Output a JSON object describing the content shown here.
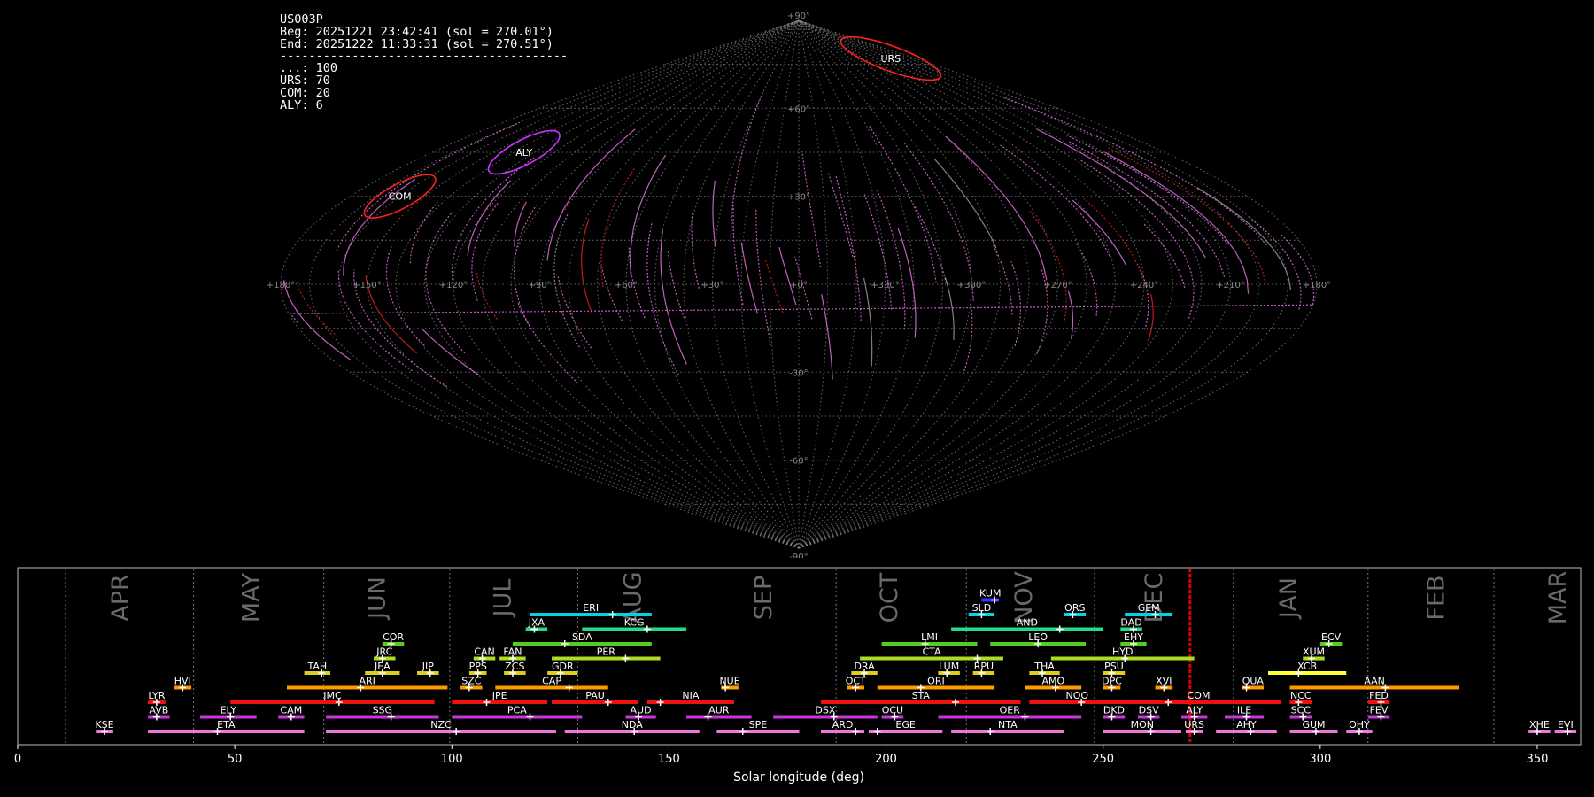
{
  "header": {
    "station": "US003P",
    "begin": "Beg: 20251221 23:42:41 (sol = 270.01°)",
    "end": "End: 20251222 11:33:31 (sol = 270.51°)",
    "separator": "----------------------------------------",
    "counts": [
      "...: 100",
      "URS: 70",
      "COM: 20",
      "ALY: 6"
    ]
  },
  "sky_map": {
    "projection": "sinusoidal",
    "lat_labels": [
      "+90°",
      "+60°",
      "+30°",
      "-30°",
      "-60°",
      "-90°"
    ],
    "lon_labels": [
      "+180°",
      "+150°",
      "+120°",
      "+90°",
      "+60°",
      "+30°",
      "+0°",
      "+330°",
      "+300°",
      "+270°",
      "+240°",
      "+210°",
      "+180°"
    ],
    "radiants": [
      {
        "code": "URS",
        "ra": 218,
        "dec": 77,
        "color": "#ff2020"
      },
      {
        "code": "ALY",
        "ra": 135,
        "dec": 45,
        "color": "#cc33ff"
      },
      {
        "code": "COM",
        "ra": 160,
        "dec": 30,
        "color": "#ff2020"
      }
    ]
  },
  "chart_data": {
    "type": "timeline",
    "xlabel": "Solar longitude (deg)",
    "xlim": [
      0,
      360
    ],
    "xticks": [
      0,
      50,
      100,
      150,
      200,
      250,
      300,
      350
    ],
    "current_sol": 270.01,
    "months": [
      {
        "name": "APR",
        "start": 11,
        "center": 24
      },
      {
        "name": "MAY",
        "start": 40.5,
        "center": 54
      },
      {
        "name": "JUN",
        "start": 70.5,
        "center": 83
      },
      {
        "name": "JUL",
        "start": 99.5,
        "center": 112
      },
      {
        "name": "AUG",
        "start": 129,
        "center": 142
      },
      {
        "name": "SEP",
        "start": 159,
        "center": 172
      },
      {
        "name": "OCT",
        "start": 188.5,
        "center": 201
      },
      {
        "name": "NOV",
        "start": 218.5,
        "center": 232
      },
      {
        "name": "DEC",
        "start": 248,
        "center": 262
      },
      {
        "name": "JAN",
        "start": 280,
        "center": 293
      },
      {
        "name": "FEB",
        "start": 311,
        "center": 327
      },
      {
        "name": "MAR",
        "start": 340,
        "center": 355
      }
    ],
    "showers": [
      {
        "code": "KUM",
        "start": 222,
        "end": 226,
        "peak": 225,
        "row": 10,
        "color": "#3333ff"
      },
      {
        "code": "ERI",
        "start": 118,
        "end": 146,
        "peak": 137,
        "row": 9,
        "color": "#00d4e6"
      },
      {
        "code": "SLD",
        "start": 219,
        "end": 225,
        "peak": 222,
        "row": 9,
        "color": "#00d4e6"
      },
      {
        "code": "ORS",
        "start": 241,
        "end": 246,
        "peak": 243,
        "row": 9,
        "color": "#00d4e6"
      },
      {
        "code": "GEM",
        "start": 255,
        "end": 266,
        "peak": 262,
        "row": 9,
        "color": "#00d4e6"
      },
      {
        "code": "JXA",
        "start": 117,
        "end": 122,
        "peak": 119,
        "row": 8,
        "color": "#22dd88"
      },
      {
        "code": "KCG",
        "start": 130,
        "end": 154,
        "peak": 145,
        "row": 8,
        "color": "#22dd88"
      },
      {
        "code": "AND",
        "start": 215,
        "end": 250,
        "peak": 240,
        "row": 8,
        "color": "#22dd88"
      },
      {
        "code": "DAD",
        "start": 254,
        "end": 259,
        "peak": 257,
        "row": 8,
        "color": "#22dd88"
      },
      {
        "code": "COR",
        "start": 84,
        "end": 89,
        "peak": 86,
        "row": 7,
        "color": "#55cc22"
      },
      {
        "code": "SDA",
        "start": 114,
        "end": 146,
        "peak": 126,
        "row": 7,
        "color": "#55cc22"
      },
      {
        "code": "LMI",
        "start": 199,
        "end": 221,
        "peak": 209,
        "row": 7,
        "color": "#55cc22"
      },
      {
        "code": "LEO",
        "start": 224,
        "end": 246,
        "peak": 235,
        "row": 7,
        "color": "#55cc22"
      },
      {
        "code": "EHY",
        "start": 254,
        "end": 260,
        "peak": 257,
        "row": 7,
        "color": "#55cc22"
      },
      {
        "code": "ECV",
        "start": 300,
        "end": 305,
        "peak": 302,
        "row": 7,
        "color": "#55cc22"
      },
      {
        "code": "JRC",
        "start": 82,
        "end": 87,
        "peak": 84,
        "row": 6,
        "color": "#aadd22"
      },
      {
        "code": "CAN",
        "start": 105,
        "end": 110,
        "peak": 107,
        "row": 6,
        "color": "#aadd22"
      },
      {
        "code": "FAN",
        "start": 111,
        "end": 117,
        "peak": 114,
        "row": 6,
        "color": "#aadd22"
      },
      {
        "code": "PER",
        "start": 123,
        "end": 148,
        "peak": 140,
        "row": 6,
        "color": "#aadd22"
      },
      {
        "code": "CTA",
        "start": 194,
        "end": 227,
        "peak": 221,
        "row": 6,
        "color": "#aadd22"
      },
      {
        "code": "HYD",
        "start": 238,
        "end": 271,
        "peak": 255,
        "row": 6,
        "color": "#aadd22"
      },
      {
        "code": "XUM",
        "start": 296,
        "end": 301,
        "peak": 298,
        "row": 6,
        "color": "#aadd22"
      },
      {
        "code": "TAH",
        "start": 66,
        "end": 72,
        "peak": 70,
        "row": 5,
        "color": "#ddcc22"
      },
      {
        "code": "JEA",
        "start": 80,
        "end": 88,
        "peak": 84,
        "row": 5,
        "color": "#ddcc22"
      },
      {
        "code": "JIP",
        "start": 92,
        "end": 97,
        "peak": 95,
        "row": 5,
        "color": "#ddcc22"
      },
      {
        "code": "PPS",
        "start": 104,
        "end": 108,
        "peak": 106,
        "row": 5,
        "color": "#ddcc22"
      },
      {
        "code": "ZCS",
        "start": 112,
        "end": 117,
        "peak": 114,
        "row": 5,
        "color": "#ddcc22"
      },
      {
        "code": "GDR",
        "start": 122,
        "end": 129,
        "peak": 125,
        "row": 5,
        "color": "#ddcc22"
      },
      {
        "code": "DRA",
        "start": 192,
        "end": 198,
        "peak": 195,
        "row": 5,
        "color": "#ddcc22"
      },
      {
        "code": "LUM",
        "start": 212,
        "end": 217,
        "peak": 214,
        "row": 5,
        "color": "#ddcc22"
      },
      {
        "code": "RPU",
        "start": 220,
        "end": 225,
        "peak": 222,
        "row": 5,
        "color": "#ddcc22"
      },
      {
        "code": "THA",
        "start": 233,
        "end": 240,
        "peak": 236,
        "row": 5,
        "color": "#ddcc22"
      },
      {
        "code": "PSU",
        "start": 250,
        "end": 255,
        "peak": 252,
        "row": 5,
        "color": "#ddcc22"
      },
      {
        "code": "XCB",
        "start": 288,
        "end": 306,
        "peak": 295,
        "row": 5,
        "color": "#ffff33"
      },
      {
        "code": "HVI",
        "start": 36,
        "end": 40,
        "peak": 38,
        "row": 4,
        "color": "#ff9900"
      },
      {
        "code": "ARI",
        "start": 62,
        "end": 99,
        "peak": 79,
        "row": 4,
        "color": "#ff9900"
      },
      {
        "code": "SZC",
        "start": 102,
        "end": 107,
        "peak": 104,
        "row": 4,
        "color": "#ff9900"
      },
      {
        "code": "CAP",
        "start": 110,
        "end": 136,
        "peak": 127,
        "row": 4,
        "color": "#ff9900"
      },
      {
        "code": "NUE",
        "start": 162,
        "end": 166,
        "peak": 163,
        "row": 4,
        "color": "#ff9900"
      },
      {
        "code": "OCT",
        "start": 191,
        "end": 195,
        "peak": 193,
        "row": 4,
        "color": "#ff9900"
      },
      {
        "code": "ORI",
        "start": 198,
        "end": 225,
        "peak": 208,
        "row": 4,
        "color": "#ff9900"
      },
      {
        "code": "AMO",
        "start": 232,
        "end": 245,
        "peak": 239,
        "row": 4,
        "color": "#ff9900"
      },
      {
        "code": "DPC",
        "start": 250,
        "end": 254,
        "peak": 252,
        "row": 4,
        "color": "#ff9900"
      },
      {
        "code": "XVI",
        "start": 262,
        "end": 266,
        "peak": 264,
        "row": 4,
        "color": "#ff9900"
      },
      {
        "code": "QUA",
        "start": 282,
        "end": 287,
        "peak": 283,
        "row": 4,
        "color": "#ff9900"
      },
      {
        "code": "AAN",
        "start": 293,
        "end": 332,
        "peak": 315,
        "row": 4,
        "color": "#ff9900"
      },
      {
        "code": "LYR",
        "start": 30,
        "end": 34,
        "peak": 32,
        "row": 3,
        "color": "#ee1111"
      },
      {
        "code": "JMC",
        "start": 49,
        "end": 96,
        "peak": 74,
        "row": 3,
        "color": "#ee1111"
      },
      {
        "code": "JPE",
        "start": 100,
        "end": 122,
        "peak": 108,
        "row": 3,
        "color": "#ee1111"
      },
      {
        "code": "PAU",
        "start": 123,
        "end": 143,
        "peak": 136,
        "row": 3,
        "color": "#ee1111"
      },
      {
        "code": "NIA",
        "start": 145,
        "end": 165,
        "peak": 148,
        "row": 3,
        "color": "#ee1111"
      },
      {
        "code": "STA",
        "start": 185,
        "end": 231,
        "peak": 216,
        "row": 3,
        "color": "#ee1111"
      },
      {
        "code": "NOO",
        "start": 233,
        "end": 255,
        "peak": 245,
        "row": 3,
        "color": "#ee1111"
      },
      {
        "code": "COM",
        "start": 253,
        "end": 291,
        "peak": 265,
        "row": 3,
        "color": "#ee1111"
      },
      {
        "code": "NCC",
        "start": 293,
        "end": 298,
        "peak": 295,
        "row": 3,
        "color": "#ee1111"
      },
      {
        "code": "FED",
        "start": 311,
        "end": 316,
        "peak": 314,
        "row": 3,
        "color": "#ee1111"
      },
      {
        "code": "AVB",
        "start": 30,
        "end": 35,
        "peak": 32,
        "row": 2,
        "color": "#cc33dd"
      },
      {
        "code": "ELY",
        "start": 42,
        "end": 55,
        "peak": 49,
        "row": 2,
        "color": "#cc33dd"
      },
      {
        "code": "CAM",
        "start": 60,
        "end": 66,
        "peak": 63,
        "row": 2,
        "color": "#cc33dd"
      },
      {
        "code": "SSG",
        "start": 71,
        "end": 97,
        "peak": 86,
        "row": 2,
        "color": "#cc33dd"
      },
      {
        "code": "PCA",
        "start": 100,
        "end": 130,
        "peak": 118,
        "row": 2,
        "color": "#cc33dd"
      },
      {
        "code": "AUD",
        "start": 140,
        "end": 147,
        "peak": 143,
        "row": 2,
        "color": "#cc33dd"
      },
      {
        "code": "AUR",
        "start": 154,
        "end": 169,
        "peak": 159,
        "row": 2,
        "color": "#cc33dd"
      },
      {
        "code": "DSX",
        "start": 174,
        "end": 198,
        "peak": 188,
        "row": 2,
        "color": "#cc33dd"
      },
      {
        "code": "OCU",
        "start": 199,
        "end": 204,
        "peak": 202,
        "row": 2,
        "color": "#cc33dd"
      },
      {
        "code": "OER",
        "start": 212,
        "end": 245,
        "peak": 232,
        "row": 2,
        "color": "#cc33dd"
      },
      {
        "code": "DKD",
        "start": 250,
        "end": 255,
        "peak": 252,
        "row": 2,
        "color": "#cc33dd"
      },
      {
        "code": "DSV",
        "start": 258,
        "end": 263,
        "peak": 261,
        "row": 2,
        "color": "#cc33dd"
      },
      {
        "code": "ALY",
        "start": 268,
        "end": 274,
        "peak": 271,
        "row": 2,
        "color": "#cc33dd"
      },
      {
        "code": "ILE",
        "start": 278,
        "end": 287,
        "peak": 283,
        "row": 2,
        "color": "#cc33dd"
      },
      {
        "code": "SCC",
        "start": 293,
        "end": 298,
        "peak": 296,
        "row": 2,
        "color": "#cc33dd"
      },
      {
        "code": "FEV",
        "start": 311,
        "end": 316,
        "peak": 314,
        "row": 2,
        "color": "#cc33dd"
      },
      {
        "code": "KSE",
        "start": 18,
        "end": 22,
        "peak": 20,
        "row": 1,
        "color": "#ee77dd"
      },
      {
        "code": "ETA",
        "start": 30,
        "end": 66,
        "peak": 46,
        "row": 1,
        "color": "#ee77dd"
      },
      {
        "code": "NZC",
        "start": 71,
        "end": 124,
        "peak": 101,
        "row": 1,
        "color": "#ee77dd"
      },
      {
        "code": "NDA",
        "start": 126,
        "end": 157,
        "peak": 142,
        "row": 1,
        "color": "#ee77dd"
      },
      {
        "code": "SPE",
        "start": 161,
        "end": 180,
        "peak": 167,
        "row": 1,
        "color": "#ee77dd"
      },
      {
        "code": "ARD",
        "start": 185,
        "end": 195,
        "peak": 193,
        "row": 1,
        "color": "#ee77dd"
      },
      {
        "code": "EGE",
        "start": 196,
        "end": 213,
        "peak": 198,
        "row": 1,
        "color": "#ee77dd"
      },
      {
        "code": "NTA",
        "start": 215,
        "end": 241,
        "peak": 224,
        "row": 1,
        "color": "#ee77dd"
      },
      {
        "code": "MON",
        "start": 250,
        "end": 268,
        "peak": 261,
        "row": 1,
        "color": "#ee77dd"
      },
      {
        "code": "URS",
        "start": 269,
        "end": 273,
        "peak": 271,
        "row": 1,
        "color": "#ee77dd"
      },
      {
        "code": "AHY",
        "start": 276,
        "end": 290,
        "peak": 284,
        "row": 1,
        "color": "#ee77dd"
      },
      {
        "code": "GUM",
        "start": 293,
        "end": 304,
        "peak": 299,
        "row": 1,
        "color": "#ee77dd"
      },
      {
        "code": "OHY",
        "start": 306,
        "end": 312,
        "peak": 309,
        "row": 1,
        "color": "#ee77dd"
      },
      {
        "code": "XHE",
        "start": 348,
        "end": 353,
        "peak": 350,
        "row": 1,
        "color": "#ee77dd"
      },
      {
        "code": "EVI",
        "start": 354,
        "end": 359,
        "peak": 357,
        "row": 1,
        "color": "#ee77dd"
      }
    ]
  }
}
